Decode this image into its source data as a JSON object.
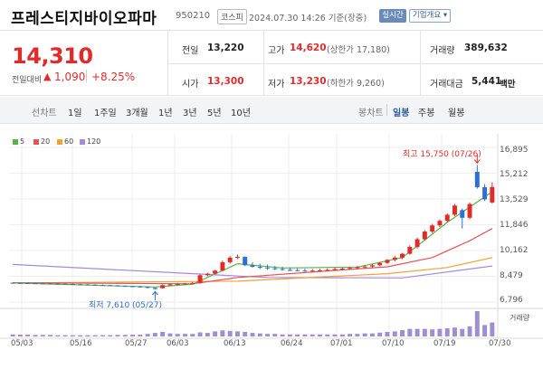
{
  "header": {
    "title": "프레스티지바이오파마",
    "code": "950210",
    "market": "코스피",
    "datetime": "2024.07.30 14:26 기준(장중)",
    "realtime_label": "실시간",
    "company_info_label": "기업개요 ▾"
  },
  "summary": {
    "price": "14,310",
    "change_label": "전일대비",
    "change_arrow": "▲",
    "change_value": "1,090",
    "change_percent": "+8.25%",
    "prev_close_label": "전일",
    "prev_close": "13,220",
    "open_label": "시가",
    "open": "13,300",
    "high_label": "고가",
    "high": "14,620",
    "upper_limit": "(상한가 17,180)",
    "low_label": "저가",
    "low": "13,230",
    "lower_limit": "(하한가 9,260)",
    "volume_label": "거래량",
    "volume": "389,632",
    "trade_value_label": "거래대금",
    "trade_value": "5,441",
    "trade_value_unit": "백만"
  },
  "period_bar": {
    "line_chart_label": "선차트",
    "line_periods": [
      "1일",
      "1주일",
      "3개월",
      "1년",
      "3년",
      "5년",
      "10년"
    ],
    "candle_chart_label": "봉차트",
    "candle_periods": [
      "일봉",
      "주봉",
      "월봉"
    ],
    "active_candle": "일봉"
  },
  "colors": {
    "up": "#e12a2a",
    "down": "#2f6fcf",
    "ma5": "#58b24b",
    "ma20": "#e35454",
    "ma60": "#f0a236",
    "ma120": "#a58ad8"
  },
  "chart_data": {
    "type": "candlestick",
    "legend": [
      "5",
      "20",
      "60",
      "120"
    ],
    "y_ticks": [
      "16,895",
      "15,212",
      "13,529",
      "11,846",
      "10,162",
      "8,479",
      "6,796"
    ],
    "ylim": [
      6796,
      16895
    ],
    "x_ticks": [
      "05/03",
      "05/16",
      "05/27",
      "06/03",
      "06/13",
      "06/24",
      "07/01",
      "07/10",
      "07/19",
      "07/30"
    ],
    "annotations": {
      "high": "최고 15,750 (07/26)",
      "low": "최저 7,610 (05/27)"
    },
    "volume_label": "거래량",
    "candles": [
      {
        "o": 8060,
        "h": 8080,
        "l": 8020,
        "c": 8050
      },
      {
        "o": 8050,
        "h": 8070,
        "l": 8010,
        "c": 8040
      },
      {
        "o": 8040,
        "h": 8070,
        "l": 8000,
        "c": 8030
      },
      {
        "o": 8030,
        "h": 8060,
        "l": 7990,
        "c": 8020
      },
      {
        "o": 8020,
        "h": 8050,
        "l": 7980,
        "c": 8010
      },
      {
        "o": 8010,
        "h": 8040,
        "l": 7970,
        "c": 8000
      },
      {
        "o": 8000,
        "h": 8030,
        "l": 7960,
        "c": 7990
      },
      {
        "o": 7990,
        "h": 8010,
        "l": 7950,
        "c": 7980
      },
      {
        "o": 7980,
        "h": 8000,
        "l": 7940,
        "c": 7960
      },
      {
        "o": 7960,
        "h": 7990,
        "l": 7920,
        "c": 7950
      },
      {
        "o": 7950,
        "h": 7980,
        "l": 7910,
        "c": 7930
      },
      {
        "o": 7930,
        "h": 7960,
        "l": 7890,
        "c": 7910
      },
      {
        "o": 7910,
        "h": 7940,
        "l": 7870,
        "c": 7900
      },
      {
        "o": 7900,
        "h": 7930,
        "l": 7850,
        "c": 7880
      },
      {
        "o": 7880,
        "h": 7900,
        "l": 7820,
        "c": 7850
      },
      {
        "o": 7850,
        "h": 7880,
        "l": 7800,
        "c": 7830
      },
      {
        "o": 7830,
        "h": 7860,
        "l": 7780,
        "c": 7810
      },
      {
        "o": 7810,
        "h": 7850,
        "l": 7760,
        "c": 7790
      },
      {
        "o": 7790,
        "h": 7820,
        "l": 7700,
        "c": 7720
      },
      {
        "o": 7720,
        "h": 7760,
        "l": 7610,
        "c": 7650
      },
      {
        "o": 7700,
        "h": 7950,
        "l": 7680,
        "c": 7900
      },
      {
        "o": 7900,
        "h": 8000,
        "l": 7850,
        "c": 7950
      },
      {
        "o": 7950,
        "h": 8050,
        "l": 7900,
        "c": 7980
      },
      {
        "o": 7980,
        "h": 8050,
        "l": 7930,
        "c": 8010
      },
      {
        "o": 8000,
        "h": 8100,
        "l": 7950,
        "c": 8050
      },
      {
        "o": 8050,
        "h": 8600,
        "l": 8000,
        "c": 8550
      },
      {
        "o": 8550,
        "h": 8700,
        "l": 8480,
        "c": 8650
      },
      {
        "o": 8650,
        "h": 8900,
        "l": 8600,
        "c": 8850
      },
      {
        "o": 8850,
        "h": 9500,
        "l": 8800,
        "c": 9400
      },
      {
        "o": 9400,
        "h": 9800,
        "l": 9300,
        "c": 9700
      },
      {
        "o": 9700,
        "h": 9900,
        "l": 9600,
        "c": 9750
      },
      {
        "o": 9750,
        "h": 9780,
        "l": 9150,
        "c": 9200
      },
      {
        "o": 9200,
        "h": 9400,
        "l": 9050,
        "c": 9100
      },
      {
        "o": 9100,
        "h": 9300,
        "l": 8950,
        "c": 9050
      },
      {
        "o": 9050,
        "h": 9250,
        "l": 8900,
        "c": 9000
      },
      {
        "o": 9000,
        "h": 9150,
        "l": 8880,
        "c": 8950
      },
      {
        "o": 8950,
        "h": 9100,
        "l": 8850,
        "c": 8900
      },
      {
        "o": 8900,
        "h": 9050,
        "l": 8820,
        "c": 8880
      },
      {
        "o": 8880,
        "h": 9000,
        "l": 8800,
        "c": 8850
      },
      {
        "o": 8850,
        "h": 8980,
        "l": 8780,
        "c": 8830
      },
      {
        "o": 8830,
        "h": 8950,
        "l": 8770,
        "c": 8850
      },
      {
        "o": 8850,
        "h": 8960,
        "l": 8790,
        "c": 8870
      },
      {
        "o": 8870,
        "h": 9000,
        "l": 8800,
        "c": 8900
      },
      {
        "o": 8900,
        "h": 9050,
        "l": 8830,
        "c": 8950
      },
      {
        "o": 8950,
        "h": 9050,
        "l": 8880,
        "c": 8980
      },
      {
        "o": 8980,
        "h": 9100,
        "l": 8900,
        "c": 9020
      },
      {
        "o": 9020,
        "h": 9150,
        "l": 8950,
        "c": 9080
      },
      {
        "o": 9080,
        "h": 9200,
        "l": 9000,
        "c": 9120
      },
      {
        "o": 9120,
        "h": 9280,
        "l": 9050,
        "c": 9200
      },
      {
        "o": 9200,
        "h": 9400,
        "l": 9150,
        "c": 9350
      },
      {
        "o": 9350,
        "h": 9600,
        "l": 9300,
        "c": 9550
      },
      {
        "o": 9550,
        "h": 9800,
        "l": 9450,
        "c": 9700
      },
      {
        "o": 9700,
        "h": 10000,
        "l": 9600,
        "c": 9950
      },
      {
        "o": 9950,
        "h": 10500,
        "l": 9900,
        "c": 10400
      },
      {
        "o": 10400,
        "h": 11000,
        "l": 10300,
        "c": 10900
      },
      {
        "o": 10900,
        "h": 11500,
        "l": 10800,
        "c": 11400
      },
      {
        "o": 11400,
        "h": 11900,
        "l": 11300,
        "c": 11800
      },
      {
        "o": 11800,
        "h": 12200,
        "l": 11700,
        "c": 12100
      },
      {
        "o": 12100,
        "h": 12600,
        "l": 12000,
        "c": 12500
      },
      {
        "o": 12500,
        "h": 13200,
        "l": 12400,
        "c": 13100
      },
      {
        "o": 12800,
        "h": 12900,
        "l": 11600,
        "c": 12300
      },
      {
        "o": 12300,
        "h": 13300,
        "l": 12200,
        "c": 13200
      },
      {
        "o": 15300,
        "h": 15750,
        "l": 14200,
        "c": 14300
      },
      {
        "o": 14300,
        "h": 14500,
        "l": 13400,
        "c": 13500
      },
      {
        "o": 13300,
        "h": 14620,
        "l": 13230,
        "c": 14310
      }
    ],
    "ma": {
      "ma5": [
        [
          0,
          8045
        ],
        [
          19,
          7780
        ],
        [
          24,
          7960
        ],
        [
          30,
          9300
        ],
        [
          36,
          9020
        ],
        [
          46,
          9080
        ],
        [
          52,
          9700
        ],
        [
          58,
          12000
        ],
        [
          64,
          14000
        ]
      ],
      "ma20": [
        [
          0,
          8060
        ],
        [
          24,
          7990
        ],
        [
          30,
          8400
        ],
        [
          44,
          8900
        ],
        [
          50,
          9100
        ],
        [
          56,
          9700
        ],
        [
          61,
          10800
        ],
        [
          64,
          11600
        ]
      ],
      "ma60": [
        [
          0,
          8050
        ],
        [
          30,
          8160
        ],
        [
          50,
          8650
        ],
        [
          58,
          9050
        ],
        [
          64,
          9700
        ]
      ],
      "ma120": [
        [
          0,
          9250
        ],
        [
          20,
          8750
        ],
        [
          34,
          8400
        ],
        [
          52,
          8370
        ],
        [
          64,
          9150
        ]
      ]
    },
    "volume": [
      0.08,
      0.07,
      0.07,
      0.06,
      0.06,
      0.06,
      0.05,
      0.05,
      0.05,
      0.05,
      0.05,
      0.05,
      0.05,
      0.05,
      0.06,
      0.06,
      0.07,
      0.07,
      0.1,
      0.14,
      0.18,
      0.12,
      0.1,
      0.1,
      0.1,
      0.16,
      0.14,
      0.2,
      0.24,
      0.22,
      0.2,
      0.18,
      0.14,
      0.12,
      0.1,
      0.1,
      0.08,
      0.08,
      0.08,
      0.08,
      0.08,
      0.08,
      0.08,
      0.08,
      0.08,
      0.1,
      0.1,
      0.12,
      0.12,
      0.15,
      0.18,
      0.2,
      0.25,
      0.3,
      0.3,
      0.3,
      0.28,
      0.3,
      0.32,
      0.35,
      0.3,
      0.4,
      1.0,
      0.45,
      0.55
    ]
  }
}
